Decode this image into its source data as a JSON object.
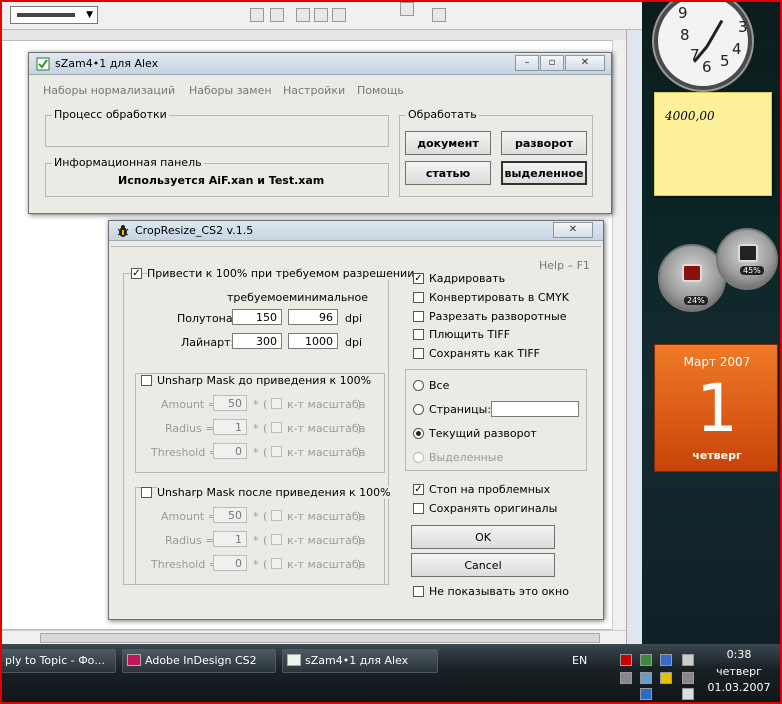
{
  "background_app": {
    "ruler_mark": "|",
    "toolbar_icons": [
      "undo-icon",
      "redo-icon",
      "align-left-icon",
      "align-center-icon",
      "align-right-icon",
      "text-frame-icon",
      "page-icon"
    ]
  },
  "szam": {
    "title": "sZam4•1 для Alex",
    "menu": [
      "Наборы нормализаций",
      "Наборы замен",
      "Настройки",
      "Помощь"
    ],
    "process_label": "Процесс обработки",
    "info_label": "Информационная панель",
    "info_text": "Используется AiF.xan и Test.xam",
    "process_group_label": "Обработать",
    "btn_document": "документ",
    "btn_spread": "разворот",
    "btn_article": "статью",
    "btn_selected": "выделенное"
  },
  "crop": {
    "title": "CropResize_CS2 v.1.5",
    "help": "Help – F1",
    "scale_group": "Привести к 100% при требуемом разрешении",
    "col_required": "требуемое",
    "col_minimal": "минимальное",
    "row_halftone": "Полутона:",
    "row_lineart": "Лайнарт:",
    "halftone_req": "150",
    "halftone_min": "96",
    "lineart_req": "300",
    "lineart_min": "1000",
    "unit": "dpi",
    "usm_before": "Unsharp Mask до приведения к 100%",
    "usm_after": "Unsharp Mask после приведения к 100%",
    "amount": "Amount =",
    "radius": "Radius =",
    "threshold": "Threshold =",
    "amount_val": "50",
    "radius_val": "1",
    "threshold_val": "0",
    "star": "*",
    "paren_open": "(",
    "paren_close": ")",
    "scale_coef": "к-т масштаба",
    "opt_crop": "Кадрировать",
    "opt_cmyk": "Конвертировать в CMYK",
    "opt_split": "Разрезать разворотные",
    "opt_flatten": "Плющить TIFF",
    "opt_save_tiff": "Сохранять как TIFF",
    "scope_all": "Все",
    "scope_pages": "Страницы:",
    "scope_current": "Текущий разворот",
    "scope_selected": "Выделенные",
    "opt_stop": "Стоп на проблемных",
    "opt_keep": "Сохранять оригиналы",
    "btn_ok": "OK",
    "btn_cancel": "Cancel",
    "opt_dont_show": "Не показывать это окно",
    "check": "✓"
  },
  "desktop": {
    "sticky_note": "4000,00",
    "gauge_cpu": "24%",
    "gauge_mem": "45%",
    "cal_month": "Март 2007",
    "cal_day": "1",
    "cal_weekday": "четверг",
    "clock_numbers": [
      "9",
      "8",
      "7",
      "6",
      "5",
      "4",
      "3"
    ]
  },
  "taskbar": {
    "btn1": "ply to Topic - Фо...",
    "btn2": "Adobe InDesign CS2",
    "btn3": "sZam4•1 для Alex",
    "lang": "EN",
    "time": "0:38",
    "weekday": "четверг",
    "date": "01.03.2007"
  }
}
